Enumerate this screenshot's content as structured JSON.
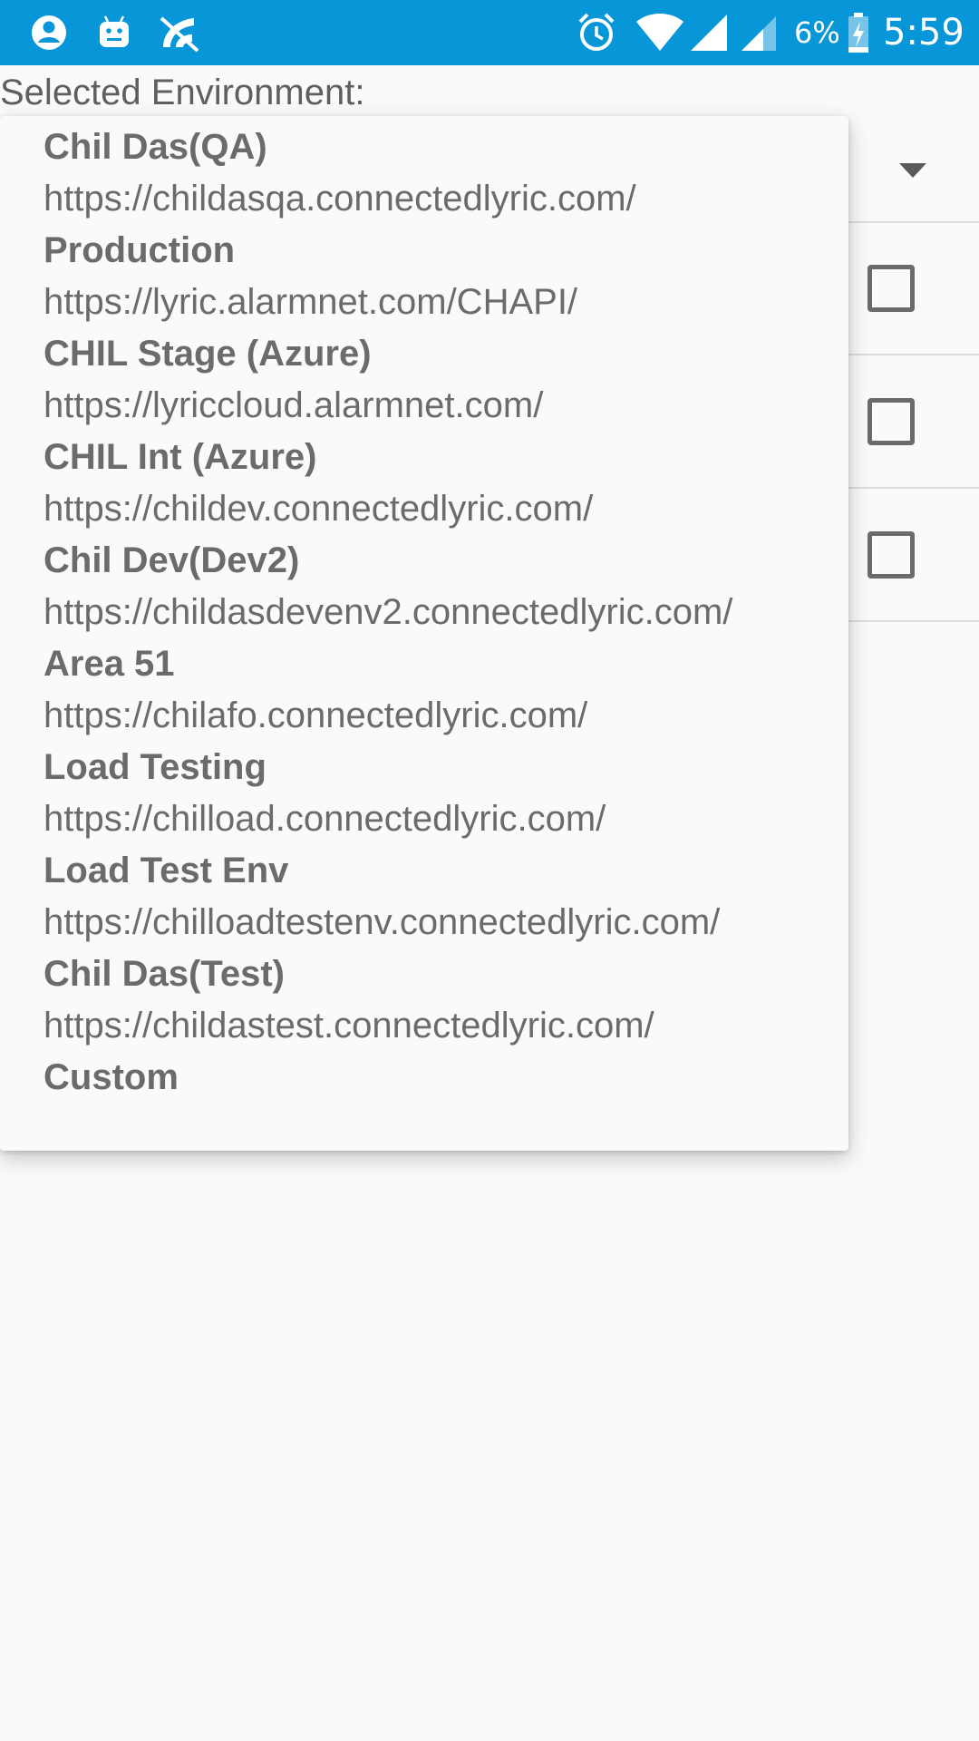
{
  "status_bar": {
    "battery": "6%",
    "time": "5:59",
    "icons": [
      "account-circle-icon",
      "android-icon",
      "sync-disabled-icon",
      "alarm-icon",
      "wifi-icon",
      "signal-icon",
      "signal-2-icon",
      "battery-charging-icon"
    ]
  },
  "environment": {
    "label": "Selected Environment:"
  },
  "dropdown": {
    "options": [
      {
        "name": "Chil Das(QA)",
        "url": "https://childasqa.connectedlyric.com/"
      },
      {
        "name": "Production",
        "url": "https://lyric.alarmnet.com/CHAPI/"
      },
      {
        "name": "CHIL Stage (Azure)",
        "url": "https://lyriccloud.alarmnet.com/"
      },
      {
        "name": "CHIL Int (Azure)",
        "url": "https://childev.connectedlyric.com/"
      },
      {
        "name": "Chil Dev(Dev2)",
        "url": "https://childasdevenv2.connectedlyric.com/"
      },
      {
        "name": "Area 51",
        "url": "https://chilafo.connectedlyric.com/"
      },
      {
        "name": "Load Testing",
        "url": "https://chilload.connectedlyric.com/"
      },
      {
        "name": "Load Test Env",
        "url": "https://chilloadtestenv.connectedlyric.com/"
      },
      {
        "name": "Chil Das(Test)",
        "url": "https://childastest.connectedlyric.com/"
      },
      {
        "name": "Custom",
        "url": ""
      }
    ]
  },
  "colors": {
    "status_bar": "#0796d7",
    "text": "#6b6b6b",
    "background": "#fafafa"
  }
}
